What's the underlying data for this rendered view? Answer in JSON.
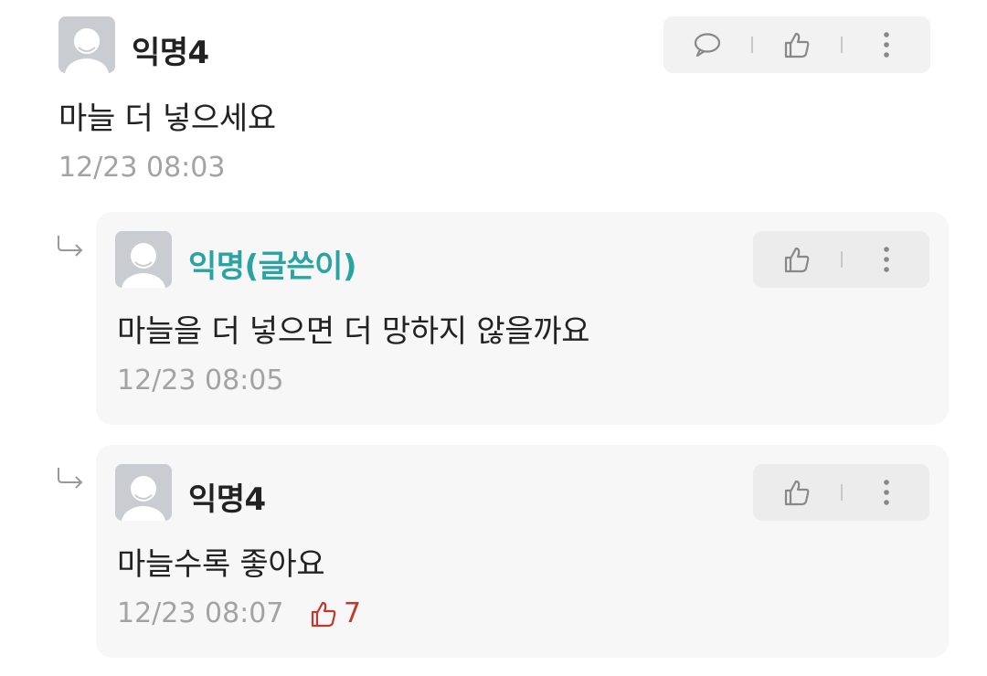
{
  "comments": [
    {
      "author": "익명4",
      "is_op": false,
      "text": "마늘 더 넣으세요",
      "time": "12/23 08:03",
      "actions": [
        "comment-icon",
        "thumbs-up-icon",
        "more-icon"
      ]
    }
  ],
  "replies": [
    {
      "author": "익명(글쓴이)",
      "is_op": true,
      "text": "마늘을 더 넣으면 더 망하지 않을까요",
      "time": "12/23 08:05",
      "actions": [
        "thumbs-up-icon",
        "more-icon"
      ]
    },
    {
      "author": "익명4",
      "is_op": false,
      "text": "마늘수록 좋아요",
      "time": "12/23 08:07",
      "likes": "7",
      "actions": [
        "thumbs-up-icon",
        "more-icon"
      ]
    }
  ],
  "colors": {
    "op_author": "#2aa3a3",
    "like_count": "#c0392b",
    "timestamp": "#a3a3a3",
    "card_bg": "#f7f7f7"
  }
}
